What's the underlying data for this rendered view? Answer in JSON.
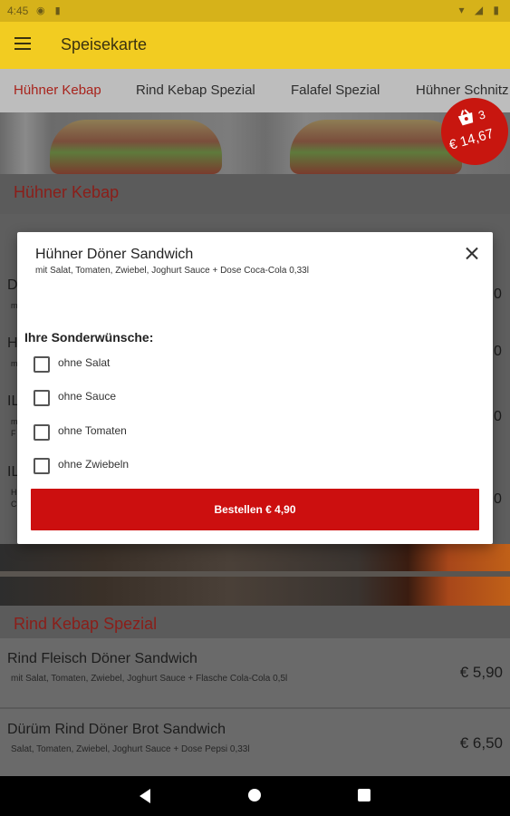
{
  "status_bar": {
    "time": "4:45"
  },
  "app_bar": {
    "title": "Speisekarte"
  },
  "tabs": [
    {
      "label": "Hühner Kebap",
      "active": true
    },
    {
      "label": "Rind Kebap Spezial",
      "active": false
    },
    {
      "label": "Falafel Spezial",
      "active": false
    },
    {
      "label": "Hühner Schnitz",
      "active": false
    }
  ],
  "cart": {
    "count": "3",
    "total": "€ 14,67"
  },
  "sections": {
    "huehner": "Hühner Kebap",
    "rind": "Rind Kebap Spezial"
  },
  "background_partials": {
    "rows": [
      {
        "initial": "D",
        "sub": "m",
        "price_tail": "0"
      },
      {
        "initial": "H",
        "sub": "m",
        "price_tail": "0"
      },
      {
        "initial": "IL",
        "sub": "m",
        "sub2": "F",
        "price_tail": "0"
      },
      {
        "initial": "IL",
        "sub": "H",
        "sub2": "C",
        "price_tail": "0"
      }
    ]
  },
  "items": [
    {
      "name": "Rind Fleisch Döner Sandwich",
      "desc": "mit Salat, Tomaten, Zwiebel, Joghurt Sauce + Flasche Cola-Cola 0,5l",
      "price": "€ 5,90"
    },
    {
      "name": "Dürüm Rind Döner Brot Sandwich",
      "desc": "Salat, Tomaten, Zwiebel, Joghurt Sauce + Dose Pepsi 0,33l",
      "price": "€ 6,50"
    }
  ],
  "dialog": {
    "title": "Hühner Döner Sandwich",
    "description": "mit Salat, Tomaten, Zwiebel, Joghurt Sauce + Dose Coca-Cola 0,33l",
    "wishes_heading": "Ihre Sonderwünsche:",
    "options": [
      {
        "label": "ohne Salat",
        "checked": false
      },
      {
        "label": "ohne Sauce",
        "checked": false
      },
      {
        "label": "ohne Tomaten",
        "checked": false
      },
      {
        "label": "ohne Zwiebeln",
        "checked": false
      }
    ],
    "order_button": "Bestellen € 4,90"
  },
  "icons": {
    "menu": "hamburger-icon",
    "close": "close-icon",
    "cart": "basket-icon",
    "nav_back": "back-triangle-icon",
    "nav_home": "home-circle-icon",
    "nav_recent": "recents-square-icon"
  },
  "colors": {
    "app_bar": "#f2cc21",
    "accent_red": "#cc0f0f",
    "section_title": "#a8231c"
  }
}
